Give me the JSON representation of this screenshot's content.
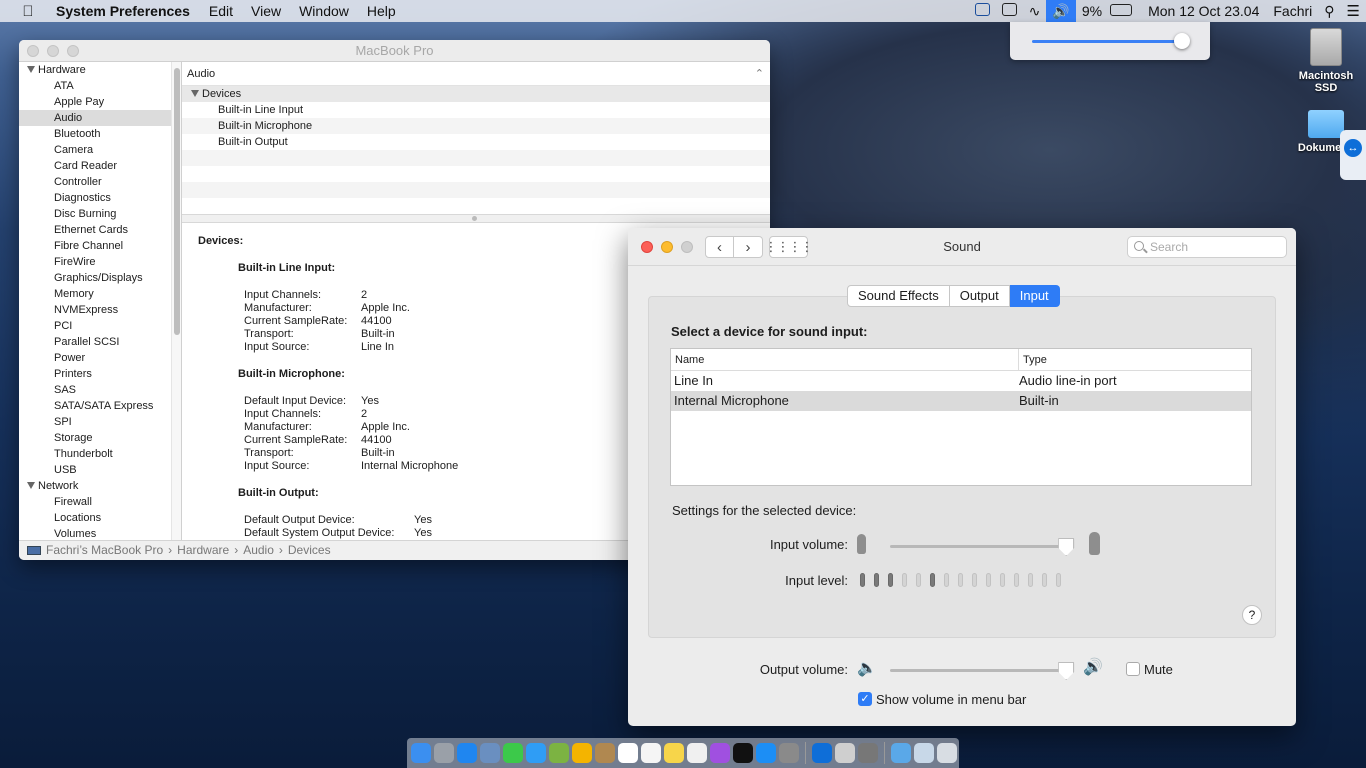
{
  "menubar": {
    "app_name": "System Preferences",
    "menus": [
      "Edit",
      "View",
      "Window",
      "Help"
    ],
    "battery": "9%",
    "datetime": "Mon 12 Oct  23.04",
    "user": "Fachri"
  },
  "volume_popover": {
    "level_fraction": 0.95
  },
  "desktop": {
    "icons": [
      {
        "label": "Macintosh SSD"
      },
      {
        "label": "Dokumen i"
      }
    ]
  },
  "sysinfo": {
    "title": "MacBook Pro",
    "sidebar": {
      "hardware_label": "Hardware",
      "hardware_items": [
        "ATA",
        "Apple Pay",
        "Audio",
        "Bluetooth",
        "Camera",
        "Card Reader",
        "Controller",
        "Diagnostics",
        "Disc Burning",
        "Ethernet Cards",
        "Fibre Channel",
        "FireWire",
        "Graphics/Displays",
        "Memory",
        "NVMExpress",
        "PCI",
        "Parallel SCSI",
        "Power",
        "Printers",
        "SAS",
        "SATA/SATA Express",
        "SPI",
        "Storage",
        "Thunderbolt",
        "USB"
      ],
      "network_label": "Network",
      "network_items": [
        "Firewall",
        "Locations",
        "Volumes"
      ],
      "selected": "Audio"
    },
    "header": "Audio",
    "tree": {
      "devices_label": "Devices",
      "items": [
        "Built-in Line Input",
        "Built-in Microphone",
        "Built-in Output"
      ]
    },
    "detail": {
      "heading": "Devices:",
      "line_input": {
        "title": "Built-in Line Input:",
        "rows": [
          [
            "Input Channels:",
            "2"
          ],
          [
            "Manufacturer:",
            "Apple Inc."
          ],
          [
            "Current SampleRate:",
            "44100"
          ],
          [
            "Transport:",
            "Built-in"
          ],
          [
            "Input Source:",
            "Line In"
          ]
        ]
      },
      "microphone": {
        "title": "Built-in Microphone:",
        "rows": [
          [
            "Default Input Device:",
            "Yes"
          ],
          [
            "Input Channels:",
            "2"
          ],
          [
            "Manufacturer:",
            "Apple Inc."
          ],
          [
            "Current SampleRate:",
            "44100"
          ],
          [
            "Transport:",
            "Built-in"
          ],
          [
            "Input Source:",
            "Internal Microphone"
          ]
        ]
      },
      "output": {
        "title": "Built-in Output:",
        "rows": [
          [
            "Default Output Device:",
            "Yes"
          ],
          [
            "Default System Output Device:",
            "Yes"
          ]
        ]
      }
    },
    "pathbar": [
      "Fachri’s MacBook Pro",
      "Hardware",
      "Audio",
      "Devices"
    ],
    "path_sep": "›"
  },
  "sound": {
    "title": "Sound",
    "search_placeholder": "Search",
    "tabs": [
      "Sound Effects",
      "Output",
      "Input"
    ],
    "active_tab": "Input",
    "select_label": "Select a device for sound input:",
    "columns": [
      "Name",
      "Type"
    ],
    "devices": [
      {
        "name": "Line In",
        "type": "Audio line-in port",
        "selected": false
      },
      {
        "name": "Internal Microphone",
        "type": "Built-in",
        "selected": true
      }
    ],
    "settings_label": "Settings for the selected device:",
    "input_volume_label": "Input volume:",
    "input_volume_fraction": 0.99,
    "input_level_label": "Input level:",
    "input_level_segments_total": 15,
    "input_level_on": [
      0,
      1,
      2,
      5
    ],
    "help_label": "?",
    "output_volume_label": "Output volume:",
    "output_volume_fraction": 0.99,
    "mute_label": "Mute",
    "mute_checked": false,
    "show_volume_label": "Show volume in menu bar",
    "show_volume_checked": true
  },
  "colors": {
    "accent": "#2e7cf6",
    "close": "#fc5f57",
    "minimize": "#fdbc2e"
  }
}
